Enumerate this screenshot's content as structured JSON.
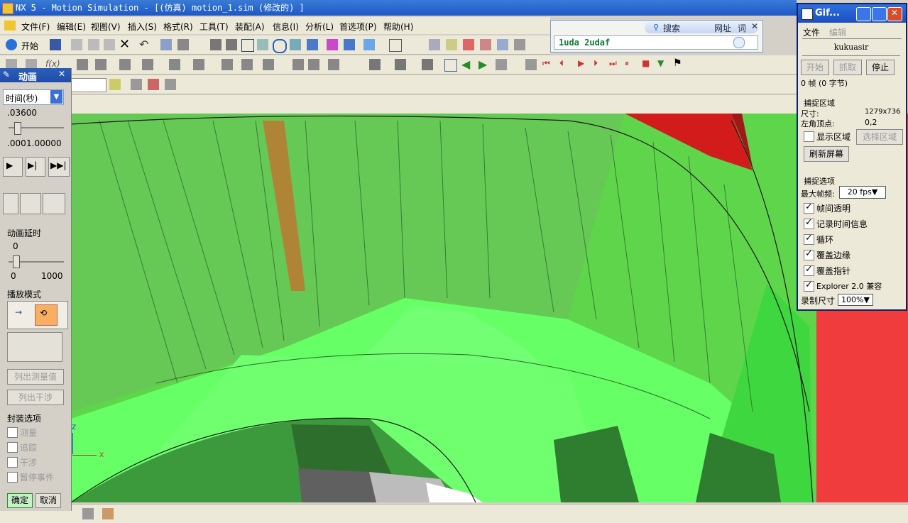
{
  "title": "NX 5 - Motion Simulation - [(仿真) motion_1.sim (修改的) ]",
  "menu": [
    "文件(F)",
    "编辑(E)",
    "视图(V)",
    "插入(S)",
    "格式(R)",
    "工具(T)",
    "装配(A)",
    "信息(I)",
    "分析(L)",
    "首选项(P)",
    "帮助(H)"
  ],
  "start_label": "开始",
  "search_bar": {
    "search_label": "搜索",
    "address_label": "网址",
    "word_label": "词",
    "input_value": "1uda 2udaf"
  },
  "anim_dialog": {
    "title": "动画",
    "time_select": "时间(秒)",
    "time_value": ".03600",
    "range_min": ".000",
    "range_max": "1.00000",
    "delay_label": "动画延时",
    "delay_value": "0",
    "delay_min": "0",
    "delay_max": "1000",
    "play_mode_label": "播放模式",
    "list_measure": "列出测量值",
    "list_interference": "列出干涉",
    "wrap_label": "封装选项",
    "wrap_items": [
      "测量",
      "追踪",
      "干涉",
      "暂停事件"
    ],
    "ok": "确定",
    "cancel": "取消"
  },
  "axis": {
    "z": "Z",
    "x": "X"
  },
  "gif": {
    "title": "Gif...",
    "menu_file": "文件",
    "menu_edit": "编辑",
    "user": "kukuasir",
    "btn_start": "开始",
    "btn_capture": "抓取",
    "btn_stop": "停止",
    "frame_info": "0 帧 (0 字节)",
    "capture_area": "捕捉区域",
    "size_label": "尺寸:",
    "size_value": "1279x736",
    "corner_label": "左角顶点:",
    "corner_value": "0,2",
    "show_area": "显示区域",
    "select_area": "选择区域",
    "refresh": "刷新屏幕",
    "capture_options": "捕捉选项",
    "fps_label": "最大帧频:",
    "fps_value": "20 fps",
    "options": [
      "帧间透明",
      "记录时间信息",
      "循环",
      "覆盖边缘",
      "覆盖指针",
      "Explorer 2.0 兼容"
    ],
    "record_size_label": "录制尺寸",
    "record_size_value": "100%"
  },
  "colors": {
    "title_bar": "#1c58c8",
    "viewport_green": "#5cd64a",
    "red_part": "#f03c3c"
  }
}
